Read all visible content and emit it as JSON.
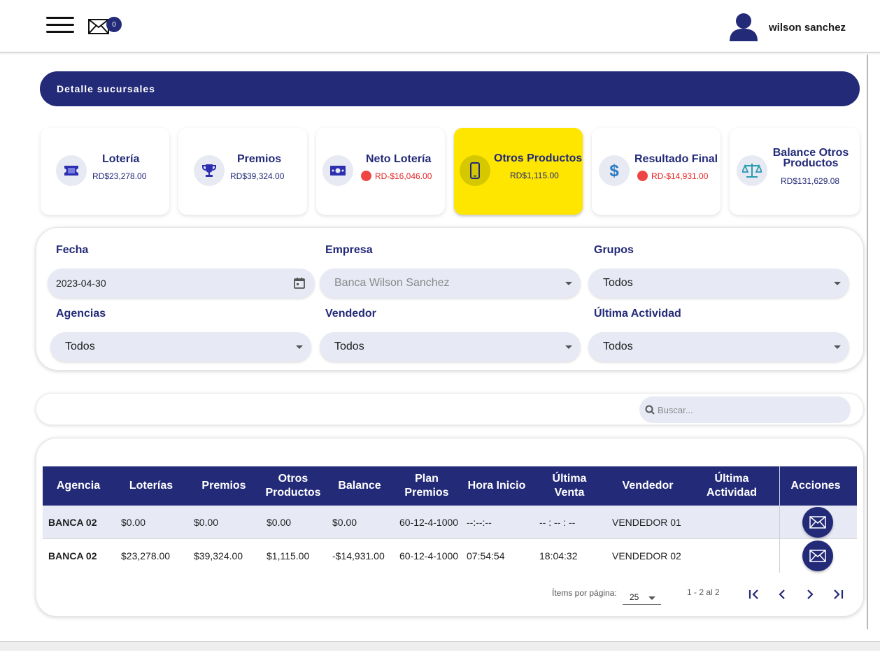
{
  "header": {
    "message_count": "0",
    "user_name": "wilson sanchez"
  },
  "page_title": "Detalle sucursales",
  "cards": [
    {
      "label": "Lotería",
      "value": "RD$23,278.00",
      "icon": "ticket-icon",
      "negative": false
    },
    {
      "label": "Premios",
      "value": "RD$39,324.00",
      "icon": "trophy-icon",
      "negative": false
    },
    {
      "label": "Neto Lotería",
      "value": "RD-$16,046.00",
      "icon": "cash-icon",
      "negative": true
    },
    {
      "label": "Otros Productos",
      "value": "RD$1,115.00",
      "icon": "phone-icon",
      "negative": false
    },
    {
      "label": "Resultado Final",
      "value": "RD-$14,931.00",
      "icon": "dollar-icon",
      "negative": true
    },
    {
      "label": "Balance Otros Productos",
      "value": "RD$131,629.08",
      "icon": "scale-icon",
      "negative": false
    }
  ],
  "filters": {
    "fecha": {
      "label": "Fecha",
      "value": "2023-04-30"
    },
    "empresa": {
      "label": "Empresa",
      "value": "Banca Wilson Sanchez"
    },
    "grupos": {
      "label": "Grupos",
      "value": "Todos"
    },
    "agencias": {
      "label": "Agencias",
      "value": "Todos"
    },
    "vendedor": {
      "label": "Vendedor",
      "value": "Todos"
    },
    "ultima_actividad": {
      "label": "Última Actividad",
      "value": "Todos"
    }
  },
  "search": {
    "placeholder": "Buscar..."
  },
  "table": {
    "columns": {
      "agencia": "Agencia",
      "loterias": "Loterías",
      "premios": "Premios",
      "otros_productos": "Otros Productos",
      "balance": "Balance",
      "plan_premios": "Plan Premios",
      "hora_inicio": "Hora Inicio",
      "ultima_venta": "Última Venta",
      "vendedor": "Vendedor",
      "ultima_actividad": "Última Actividad",
      "acciones": "Acciones"
    },
    "rows": [
      {
        "agencia": "BANCA 02",
        "loterias": "$0.00",
        "premios": "$0.00",
        "otros_productos": "$0.00",
        "balance": "$0.00",
        "plan_premios": "60-12-4-1000",
        "hora_inicio": "--:--:--",
        "ultima_venta": "-- : -- : --",
        "vendedor": "VENDEDOR 01",
        "ultima_actividad": ""
      },
      {
        "agencia": "BANCA 02",
        "loterias": "$23,278.00",
        "premios": "$39,324.00",
        "otros_productos": "$1,115.00",
        "balance": "-$14,931.00",
        "plan_premios": "60-12-4-1000",
        "hora_inicio": "07:54:54",
        "ultima_venta": "18:04:32",
        "vendedor": "VENDEDOR 02",
        "ultima_actividad": ""
      }
    ]
  },
  "paginator": {
    "items_label": "Ítems por página:",
    "page_size": "25",
    "range": "1 - 2 al 2"
  },
  "colors": {
    "primary": "#232a78",
    "highlight": "#ffe600",
    "negative": "#e52222",
    "field_bg": "#e7e9f5"
  }
}
